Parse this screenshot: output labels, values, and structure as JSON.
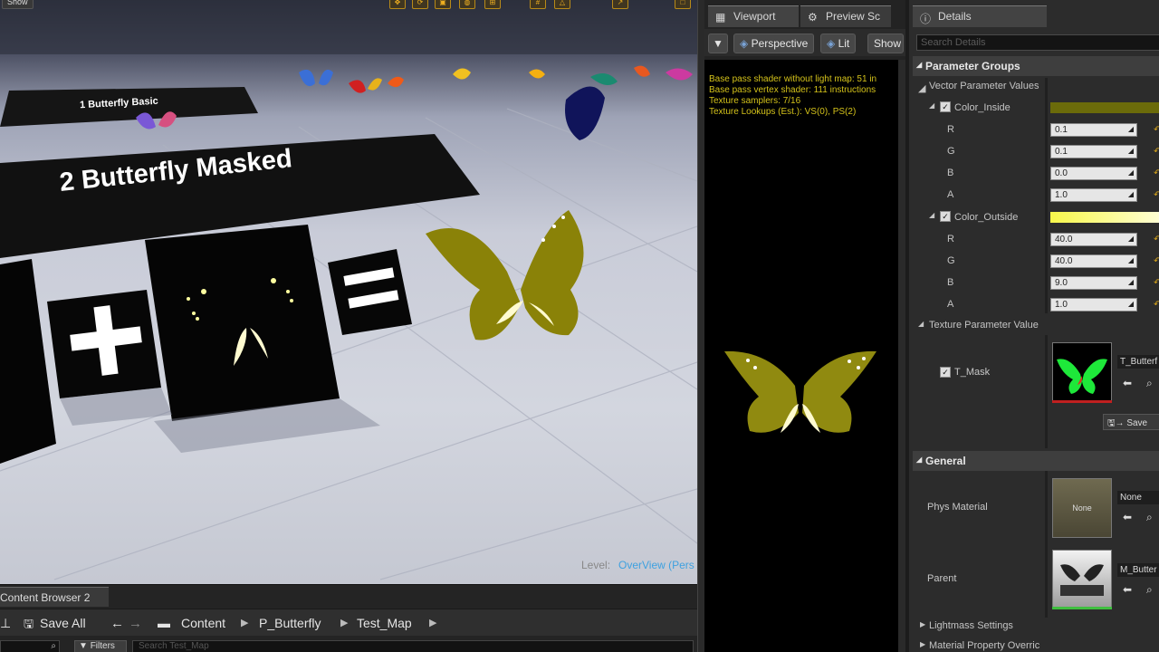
{
  "viewport": {
    "top_button": "Show",
    "sign_small": "1  Butterfly Basic",
    "sign_big": "2  Butterfly Masked",
    "level_label": "Level:",
    "level_value": "OverView (Pers"
  },
  "content_browser": {
    "tab": "Content Browser 2",
    "save_all": "Save All",
    "path": [
      "Content",
      "P_Butterfly",
      "Test_Map"
    ],
    "filters": "Filters",
    "search_placeholder": "Search Test_Map"
  },
  "preview": {
    "tabs": [
      "Viewport",
      "Preview Sc"
    ],
    "buttons": {
      "perspective": "Perspective",
      "lit": "Lit",
      "show": "Show"
    },
    "stats": [
      "Base pass shader without light map: 51 in",
      "Base pass vertex shader: 111 instructions",
      "Texture samplers: 7/16",
      "Texture Lookups (Est.): VS(0), PS(2)"
    ]
  },
  "details": {
    "tab": "Details",
    "search_placeholder": "Search Details",
    "parameter_groups": "Parameter Groups",
    "vector_params": "Vector Parameter Values",
    "color_inside": {
      "label": "Color_Inside",
      "color": "#6b6b0a",
      "channels": [
        {
          "name": "R",
          "value": "0.1"
        },
        {
          "name": "G",
          "value": "0.1"
        },
        {
          "name": "B",
          "value": "0.0"
        },
        {
          "name": "A",
          "value": "1.0"
        }
      ]
    },
    "color_outside": {
      "label": "Color_Outside",
      "color": "#f5f53a",
      "channels": [
        {
          "name": "R",
          "value": "40.0"
        },
        {
          "name": "G",
          "value": "40.0"
        },
        {
          "name": "B",
          "value": "9.0"
        },
        {
          "name": "A",
          "value": "1.0"
        }
      ]
    },
    "texture_params": "Texture Parameter Value",
    "t_mask": {
      "label": "T_Mask",
      "asset": "T_Butterf",
      "save": "Save"
    },
    "general": "General",
    "phys_material": {
      "label": "Phys Material",
      "thumb_text": "None",
      "asset": "None"
    },
    "parent": {
      "label": "Parent",
      "asset": "M_Butter"
    },
    "lightmass": "Lightmass Settings",
    "material_override": "Material Property Overric"
  }
}
